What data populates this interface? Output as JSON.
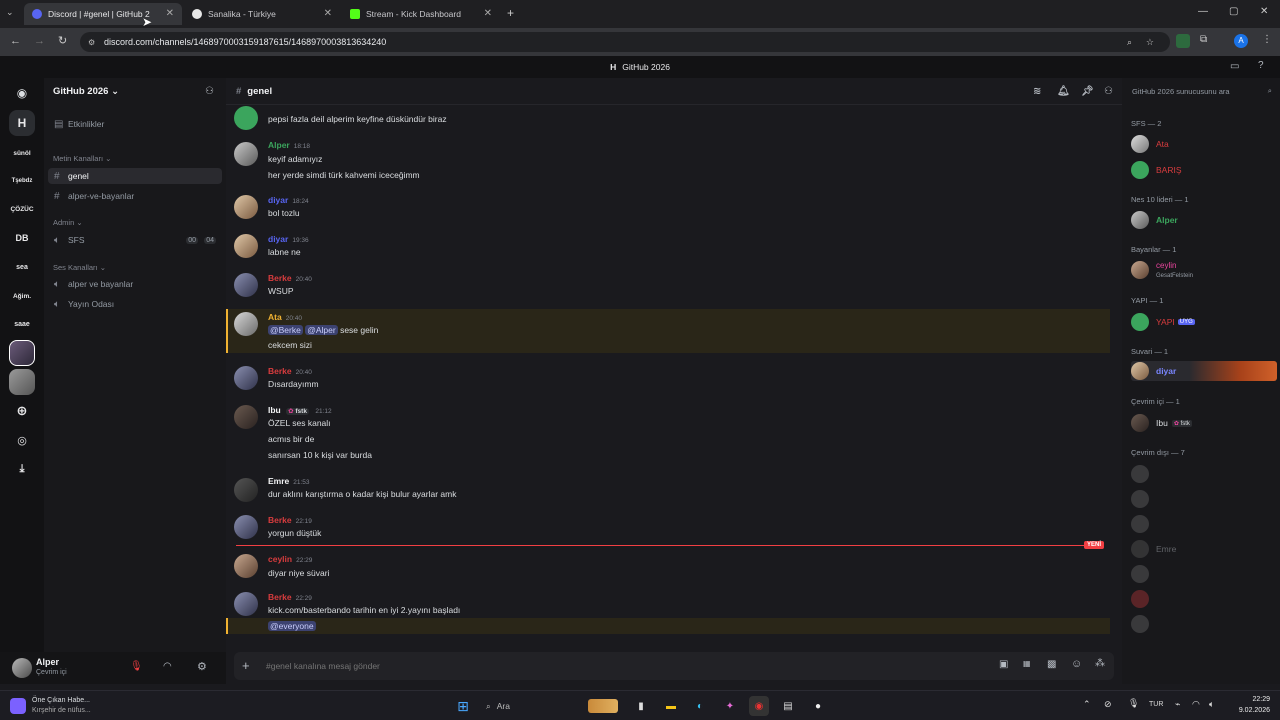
{
  "browser": {
    "tabs": [
      {
        "title": "Discord | #genel | GitHub 2"
      },
      {
        "title": "Sanalika - Türkiye"
      },
      {
        "title": "Stream - Kick Dashboard"
      }
    ],
    "url": "discord.com/channels/1468970003159187615/1468970003813634240"
  },
  "banner": {
    "server_name": "GitHub 2026"
  },
  "rail": {
    "servers": [
      "H",
      "sünöl",
      "Tşebdz",
      "ÇÖZÜC",
      "DB",
      "sea",
      "Ağim.",
      "saae"
    ]
  },
  "sidebar": {
    "server_name": "GitHub 2026",
    "events_label": "Etkinlikler",
    "text_category": "Metin Kanalları",
    "text_channels": [
      "genel",
      "alper-ve-bayanlar"
    ],
    "admin_category": "Admin",
    "admin_channels": [
      {
        "name": "SFS",
        "counter_a": "00",
        "counter_b": "04"
      }
    ],
    "voice_category": "Ses Kanalları",
    "voice_channels": [
      "alper ve bayanlar",
      "Yayın Odası"
    ]
  },
  "user": {
    "name": "Alper",
    "status": "Çevrim içi"
  },
  "channel": {
    "name": "genel",
    "composer_placeholder": "#genel kanalına mesaj gönder"
  },
  "messages": [
    {
      "author": "",
      "time": "",
      "lines": [
        "pepsi fazla deil alperim keyfine düskündür biraz"
      ],
      "color": "#d83c3e"
    },
    {
      "author": "Alper",
      "time": "18:18",
      "lines": [
        "keyif adamıyız",
        "her yerde simdi türk kahvemi iceceğimm"
      ],
      "color": "#3ba55d"
    },
    {
      "author": "diyar",
      "time": "18:24",
      "lines": [
        "bol tozlu"
      ],
      "color": "#5865f2"
    },
    {
      "author": "diyar",
      "time": "19:36",
      "lines": [
        "labne ne"
      ],
      "color": "#5865f2"
    },
    {
      "author": "Berke",
      "time": "20:40",
      "lines": [
        "WSUP"
      ],
      "color": "#d83c3e"
    },
    {
      "author": "Ata",
      "time": "20:40",
      "mentions": [
        "@Berke",
        "@Alper"
      ],
      "lines": [
        "sese gelin",
        "cekcem sizi"
      ],
      "color": "#f0b232"
    },
    {
      "author": "Berke",
      "time": "20:40",
      "lines": [
        "Dısardayımm"
      ],
      "color": "#d83c3e"
    },
    {
      "author": "Ibu",
      "tag": "fstk",
      "time": "21:12",
      "lines": [
        "ÖZEL ses kanalı",
        "acmıs bir de",
        "sanırsan 10 k kişi var burda"
      ],
      "color": "#f2f3f5"
    },
    {
      "author": "Emre",
      "time": "21:53",
      "lines": [
        "dur aklını karıştırma o kadar kişi bulur ayarlar amk"
      ],
      "color": "#f2f3f5"
    },
    {
      "author": "Berke",
      "time": "22:19",
      "lines": [
        "yorgun düştük"
      ],
      "color": "#d83c3e"
    },
    {
      "author": "ceylin",
      "time": "22:29",
      "lines": [
        "diyar niye süvari"
      ],
      "color": "#d83c3e"
    },
    {
      "author": "Berke",
      "time": "22:29",
      "lines": [
        "kick.com/basterbando tarihin en iyi 2.yayını başladı",
        "@everyone"
      ],
      "color": "#d83c3e"
    }
  ],
  "new_marker": "YENİ",
  "members": {
    "search_placeholder": "GitHub 2026 sunucusunu ara",
    "groups": [
      {
        "title": "SFS — 2",
        "items": [
          {
            "name": "Ata",
            "color": "#d83c3e"
          },
          {
            "name": "BARIŞ",
            "color": "#d83c3e"
          }
        ]
      },
      {
        "title": "Nes 10 lideri — 1",
        "items": [
          {
            "name": "Alper",
            "color": "#3ba55d"
          }
        ]
      },
      {
        "title": "Bayanlar — 1",
        "items": [
          {
            "name": "ceylin",
            "color": "#eb459e",
            "sub": "GesatFelstein"
          }
        ]
      },
      {
        "title": "YAPI — 1",
        "items": [
          {
            "name": "YAPI",
            "color": "#d83c3e",
            "badge": "UYG"
          }
        ]
      },
      {
        "title": "Suvari — 1",
        "items": [
          {
            "name": "diyar",
            "color": "#5865f2"
          }
        ]
      },
      {
        "title": "Çevrim içi — 1",
        "items": [
          {
            "name": "Ibu",
            "color": "#dbdee1",
            "badge": "fstk"
          }
        ]
      },
      {
        "title": "Çevrim dışı — 7",
        "items": [
          {
            "name": "",
            "color": "#d83c3e"
          },
          {
            "name": "",
            "color": "#d83c3e"
          },
          {
            "name": "",
            "color": "#d83c3e"
          },
          {
            "name": "Emre",
            "color": "#80848e"
          },
          {
            "name": "",
            "color": "#d83c3e"
          },
          {
            "name": "",
            "color": "#d83c3e"
          },
          {
            "name": "",
            "color": "#d83c3e"
          }
        ]
      }
    ]
  },
  "taskbar": {
    "news_title": "Öne Çıkan Habe...",
    "news_sub": "Kırşehir de nüfus...",
    "search_label": "Ara",
    "lang": "TUR",
    "time": "22:29",
    "date": "9.02.2026"
  }
}
